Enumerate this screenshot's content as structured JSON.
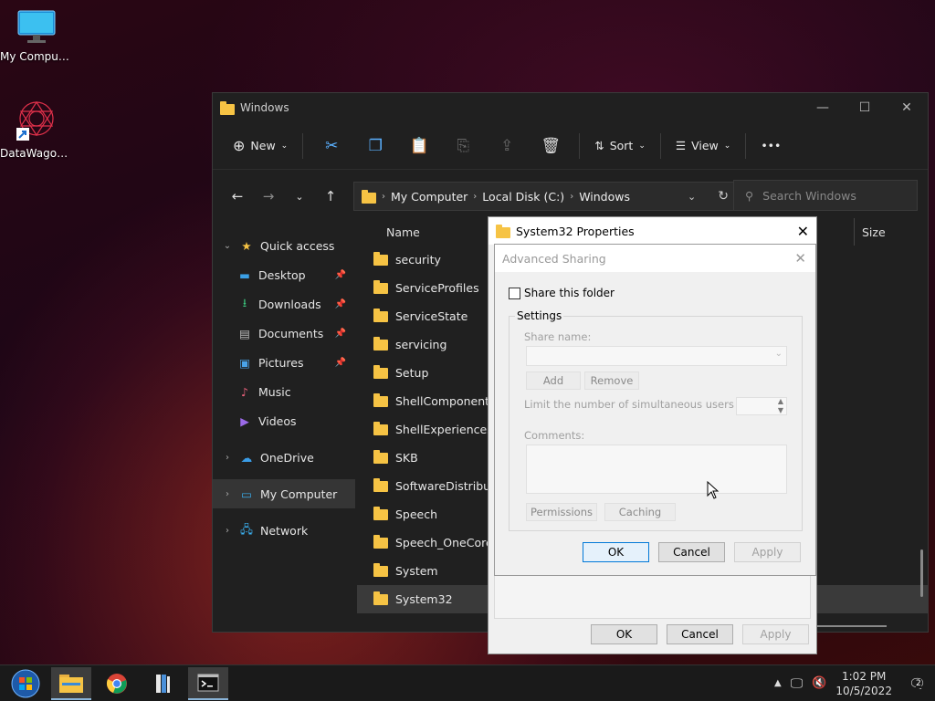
{
  "desktop": {
    "icons": [
      {
        "label": "My Computer"
      },
      {
        "label": "DataWagon..."
      }
    ]
  },
  "explorer": {
    "title": "Windows",
    "toolbar": {
      "new_label": "New",
      "sort_label": "Sort",
      "view_label": "View",
      "more_label": "•••"
    },
    "address": {
      "crumbs": [
        "My Computer",
        "Local Disk (C:)",
        "Windows"
      ]
    },
    "search": {
      "placeholder": "Search Windows"
    },
    "nav": {
      "quick_access": "Quick access",
      "items": [
        {
          "label": "Desktop"
        },
        {
          "label": "Downloads"
        },
        {
          "label": "Documents"
        },
        {
          "label": "Pictures"
        },
        {
          "label": "Music"
        },
        {
          "label": "Videos"
        }
      ],
      "onedrive": "OneDrive",
      "my_computer": "My Computer",
      "network": "Network"
    },
    "columns": {
      "name": "Name",
      "size": "Size"
    },
    "files": [
      "security",
      "ServiceProfiles",
      "ServiceState",
      "servicing",
      "Setup",
      "ShellComponents",
      "ShellExperiences",
      "SKB",
      "SoftwareDistribution",
      "Speech",
      "Speech_OneCore",
      "System",
      "System32"
    ]
  },
  "properties_dialog": {
    "title": "System32 Properties",
    "ok": "OK",
    "cancel": "Cancel",
    "apply": "Apply"
  },
  "advanced_sharing": {
    "title": "Advanced Sharing",
    "share_checkbox": "Share this folder",
    "settings_group": "Settings",
    "share_name_label": "Share name:",
    "add": "Add",
    "remove": "Remove",
    "limit_label": "Limit the number of simultaneous users to:",
    "comments_label": "Comments:",
    "permissions": "Permissions",
    "caching": "Caching",
    "ok": "OK",
    "cancel": "Cancel",
    "apply": "Apply"
  },
  "taskbar": {
    "time": "1:02 PM",
    "date": "10/5/2022",
    "notification_count": "2"
  },
  "colors": {
    "explorer_bg": "#202020",
    "accent": "#5ab0ff",
    "folder": "#f6c344",
    "dialog_bg": "#f0f0f0"
  }
}
